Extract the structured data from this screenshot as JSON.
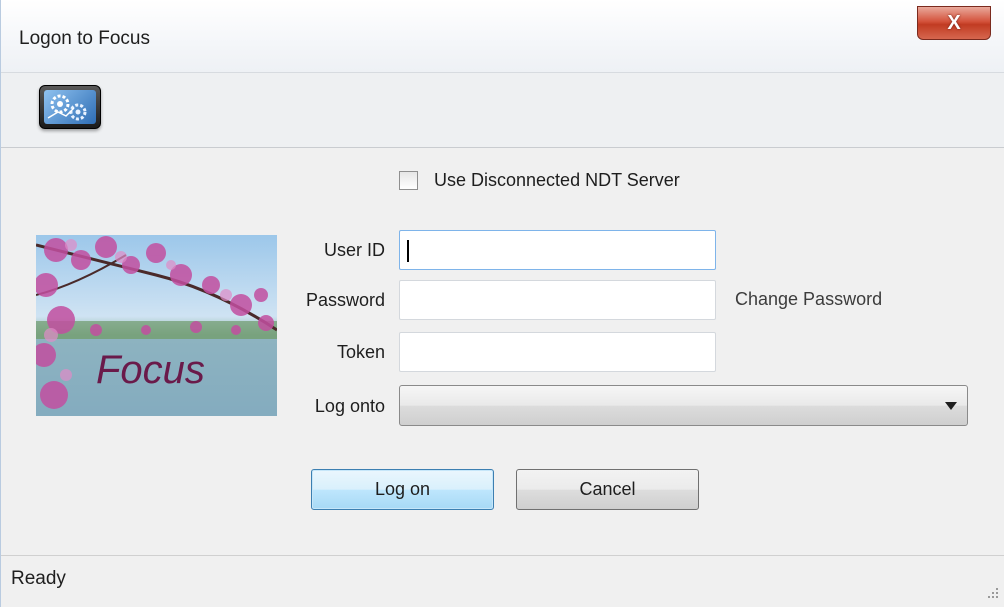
{
  "window": {
    "title": "Logon to Focus",
    "close_symbol": "X"
  },
  "toolbar": {
    "app_icon": "focus-app-icon"
  },
  "form": {
    "disconnected_checkbox": {
      "label": "Use Disconnected NDT Server",
      "checked": false
    },
    "logo_text": "Focus",
    "user_id": {
      "label": "User ID",
      "value": ""
    },
    "password": {
      "label": "Password",
      "value": ""
    },
    "change_password_link": "Change Password",
    "token": {
      "label": "Token",
      "value": ""
    },
    "log_onto": {
      "label": "Log onto",
      "selected": ""
    }
  },
  "buttons": {
    "log_on": "Log on",
    "cancel": "Cancel"
  },
  "status": {
    "text": "Ready"
  }
}
